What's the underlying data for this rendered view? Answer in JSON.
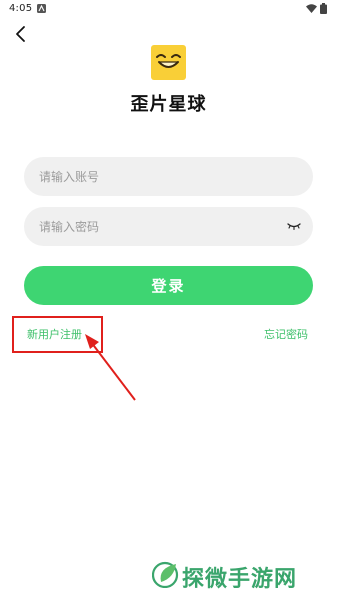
{
  "status_bar": {
    "time": "4:05",
    "notification_icon": "a-badge-icon",
    "wifi_icon": "wifi-icon",
    "battery_icon": "battery-icon"
  },
  "app": {
    "title": "歪片星球",
    "logo_icon": "smiling-face-logo"
  },
  "form": {
    "account_placeholder": "请输入账号",
    "account_value": "",
    "password_placeholder": "请输入密码",
    "password_value": "",
    "eye_icon": "closed-eye-icon",
    "login_label": "登录",
    "register_label": "新用户注册",
    "forgot_label": "忘记密码"
  },
  "colors": {
    "accent": "#3ed572",
    "link": "#3ec06a",
    "input_bg": "#f0f0f0",
    "annotation": "#e0201c"
  },
  "watermark": {
    "text": "探微手游网"
  }
}
